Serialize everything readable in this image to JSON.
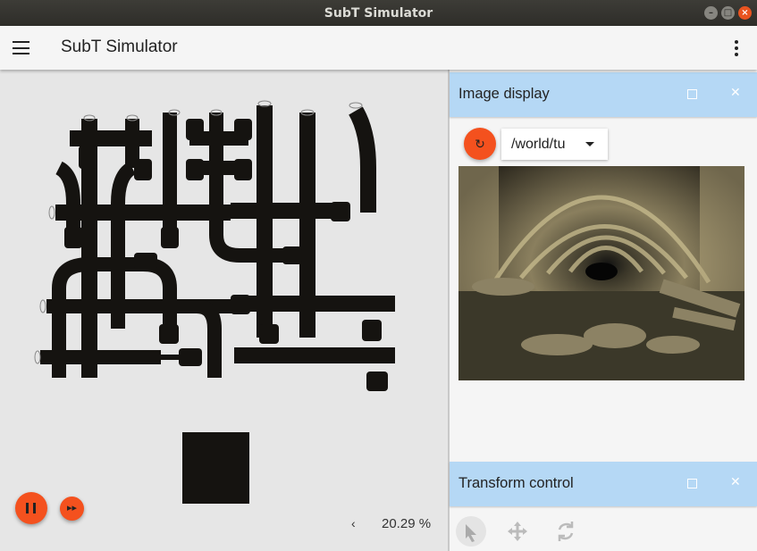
{
  "window": {
    "title": "SubT Simulator"
  },
  "appbar": {
    "title": "SubT Simulator"
  },
  "scene": {
    "zoom_back": "‹",
    "zoom_label": "20.29 %"
  },
  "image_display": {
    "title": "Image display",
    "refresh_glyph": "↻",
    "topic_value": "/world/tu"
  },
  "transform_control": {
    "title": "Transform control"
  },
  "icons": {
    "window_minimize": "minimize-icon",
    "window_maximize": "maximize-icon",
    "window_close": "close-icon",
    "menu": "hamburger-menu-icon",
    "overflow": "more-vert-icon",
    "pause": "pause-icon",
    "step": "fast-forward-icon",
    "select_tool": "select-pointer-icon",
    "translate_tool": "translate-move-icon",
    "rotate_tool": "rotate-icon"
  },
  "colors": {
    "accent": "#f4511e",
    "panel_header": "#b5d8f5",
    "titlebar": "#2e2d29",
    "close": "#e95420"
  }
}
